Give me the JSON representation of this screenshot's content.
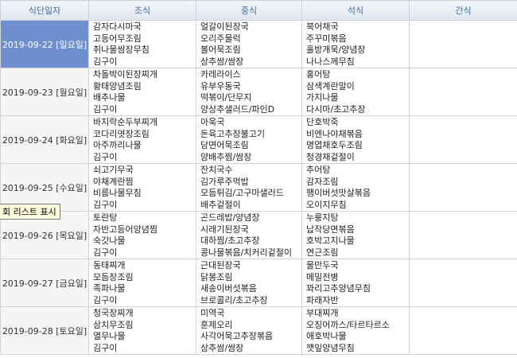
{
  "headers": [
    "식단일자",
    "조식",
    "중식",
    "석식",
    "간식"
  ],
  "rows": [
    {
      "date": "2019-09-22 [일요일]",
      "selected": true,
      "breakfast": [
        "감자다시마국",
        "고등어무조림",
        "취나물쌈장무침",
        "김구이"
      ],
      "lunch": [
        "얼갈이된장국",
        "오리주물럭",
        "볼어묵조림",
        "상추쌈/쌈장"
      ],
      "dinner": [
        "북어채국",
        "주꾸미볶음",
        "홀방개묵/양념장",
        "나나스께무침"
      ],
      "snack": []
    },
    {
      "date": "2019-09-23 [월요일]",
      "selected": false,
      "breakfast": [
        "차돌박이된장찌개",
        "황태양념조림",
        "배추나물",
        "김구이"
      ],
      "lunch": [
        "카레라이스",
        "유부우동국",
        "떡볶이/단무지",
        "양상추샐러드/파인D"
      ],
      "dinner": [
        "홍어탕",
        "삼색계란말이",
        "가지나물",
        "다시마/초고추장"
      ],
      "snack": []
    },
    {
      "date": "2019-09-24 [화요일]",
      "selected": false,
      "breakfast": [
        "바지락순두부찌개",
        "코다리엿장조림",
        "아주까리나물",
        "김구이"
      ],
      "lunch": [
        "아욱국",
        "돈육고추장불고기",
        "당면어묵조림",
        "양배추찜/쌈장"
      ],
      "dinner": [
        "단호박죽",
        "비엔나야채볶음",
        "명엽채호두조림",
        "청경채겉절이"
      ],
      "snack": []
    },
    {
      "date": "2019-09-25 [수요일]",
      "selected": false,
      "breakfast": [
        "쇠고기무국",
        "야채계란찜",
        "비름나물무침",
        "김구이"
      ],
      "lunch": [
        "잔치국수",
        "김가루주먹밥",
        "모듬튀김/고구마샐러드",
        "배추겉절이"
      ],
      "dinner": [
        "추어탕",
        "감자조림",
        "팽이버섯맛살볶음",
        "오이지무침"
      ],
      "snack": []
    },
    {
      "date": "2019-09-26 [목요일]",
      "selected": false,
      "breakfast": [
        "토란탕",
        "자반고등어양념찜",
        "숙갓나물",
        "김구이"
      ],
      "lunch": [
        "곤드레밥/양념장",
        "시래기된장국",
        "대하찜/초고추장",
        "콩나물볶음/치커리겉절이"
      ],
      "dinner": [
        "누룽지탕",
        "납작당면볶음",
        "호박고지나물",
        "연근조림"
      ],
      "snack": []
    },
    {
      "date": "2019-09-27 [금요일]",
      "selected": false,
      "breakfast": [
        "동태찌개",
        "모듬장조림",
        "족파나물",
        "김구이"
      ],
      "lunch": [
        "근대된장국",
        "닭봉조림",
        "새송이버섯볶음",
        "브로콜리/초고추장"
      ],
      "dinner": [
        "물만두국",
        "메밀전병",
        "꽈리고추양념무침",
        "파래자반"
      ],
      "snack": []
    },
    {
      "date": "2019-09-28 [토요일]",
      "selected": false,
      "breakfast": [
        "청국장찌개",
        "삼치무조림",
        "열무나물",
        "김구이"
      ],
      "lunch": [
        "미역국",
        "훈제오리",
        "사각어묵고추장볶음",
        "상추쌈/쌈장"
      ],
      "dinner": [
        "부대찌개",
        "오징어까스/타르타르소",
        "애호박나물",
        "깻잎양념무침"
      ],
      "snack": []
    }
  ],
  "tooltip": "회 리스트 표시"
}
